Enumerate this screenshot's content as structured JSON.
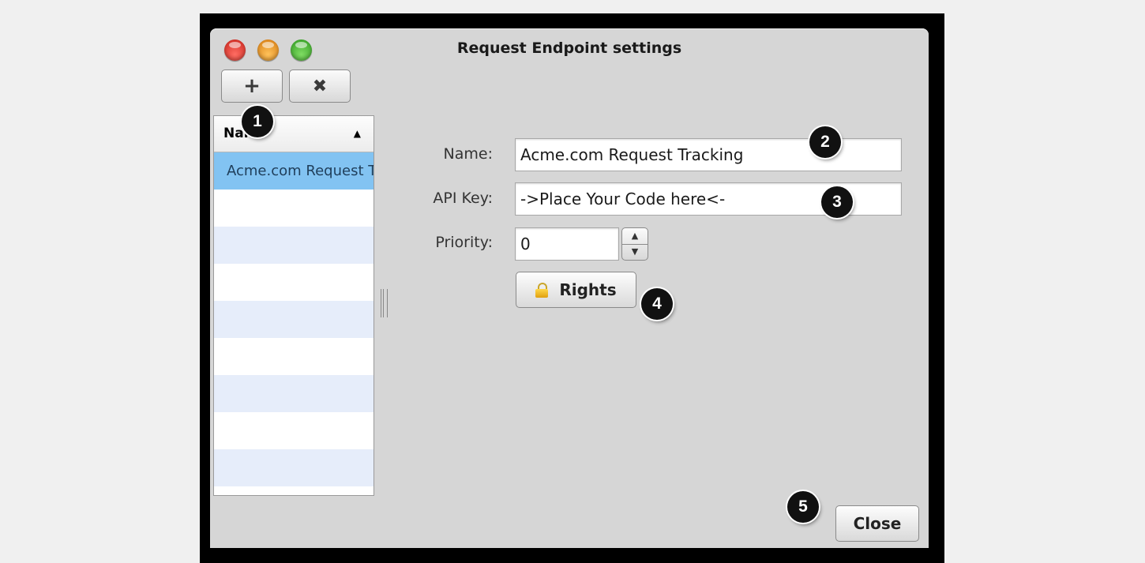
{
  "window": {
    "title": "Request Endpoint settings"
  },
  "toolbar": {
    "add_label": "+",
    "delete_label": "✖"
  },
  "list": {
    "header": "Name",
    "sort_indicator": "▲",
    "items": [
      "Acme.com Request Tracking"
    ]
  },
  "form": {
    "name_label": "Name:",
    "name_value": "Acme.com Request Tracking",
    "api_key_label": "API Key:",
    "api_key_value": "->Place Your Code here<-",
    "priority_label": "Priority:",
    "priority_value": "0",
    "stepper_up": "▲",
    "stepper_down": "▼",
    "rights_label": "Rights"
  },
  "footer": {
    "close_label": "Close"
  },
  "callouts": [
    "1",
    "2",
    "3",
    "4",
    "5"
  ],
  "icons": {
    "lock": "lock-icon",
    "add": "plus-icon",
    "delete": "close-icon"
  },
  "colors": {
    "selection": "#82c3f2",
    "row_alt": "#e6edfa",
    "window_bg": "#d6d6d6"
  }
}
